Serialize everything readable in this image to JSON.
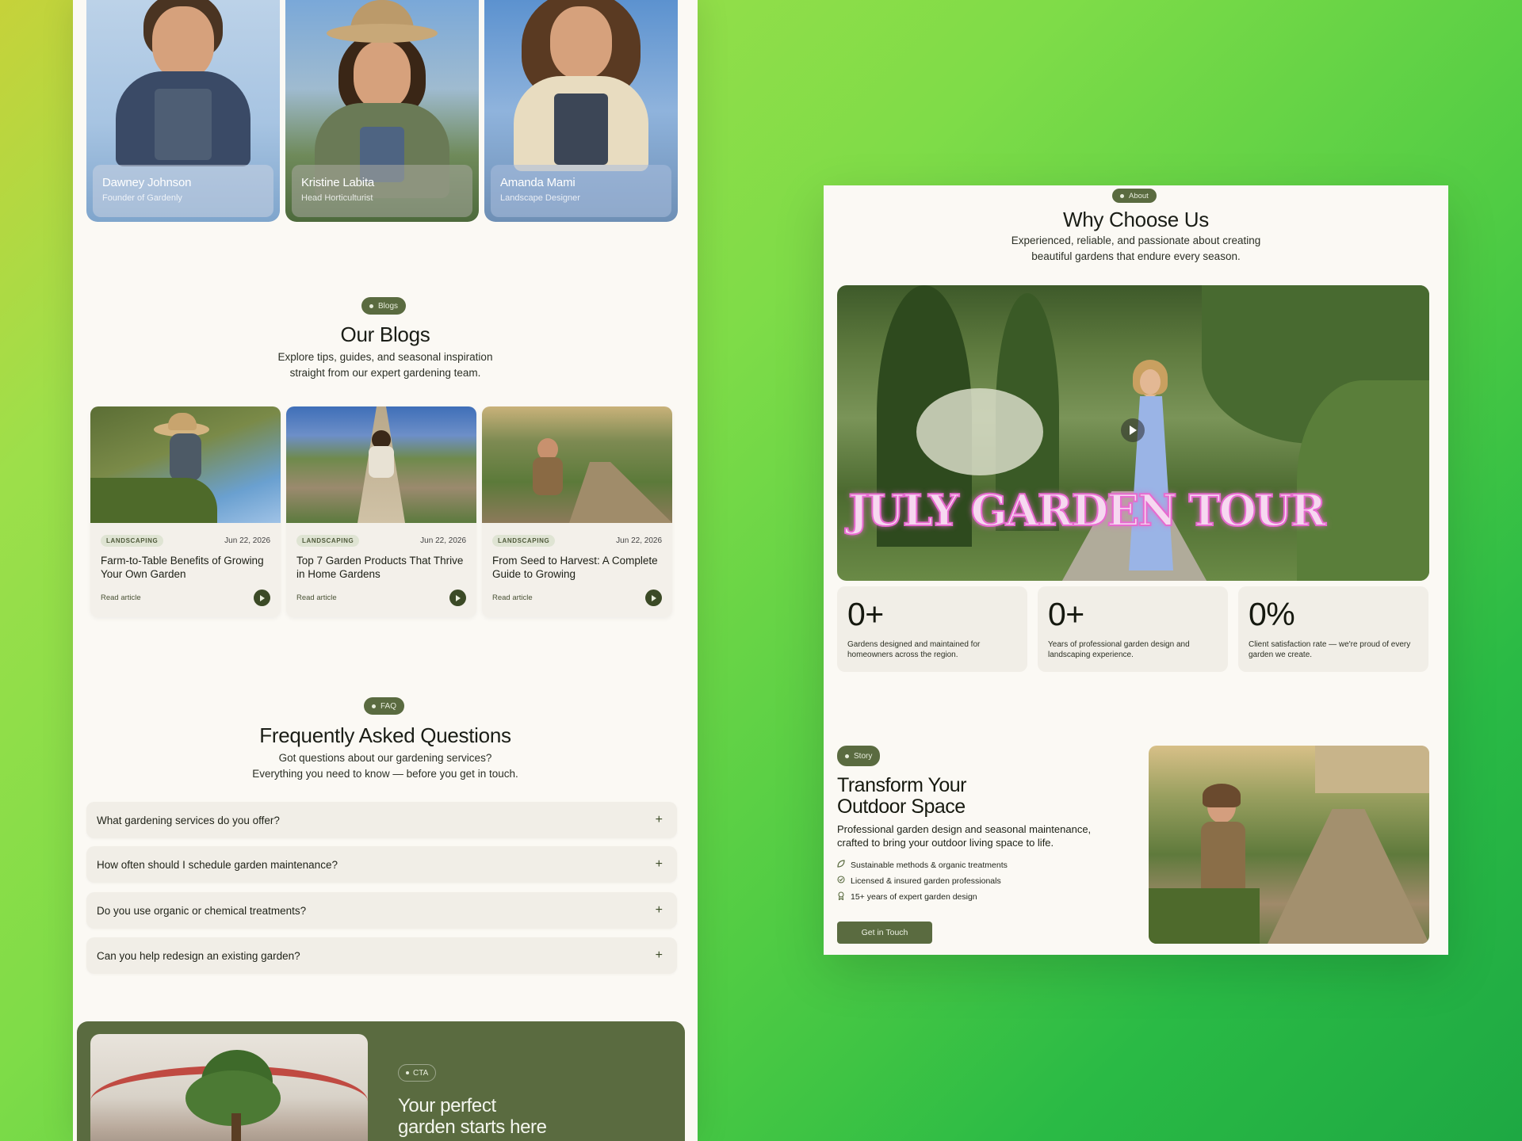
{
  "team": [
    {
      "name": "Dawney Johnson",
      "role": "Founder of Gardenly"
    },
    {
      "name": "Kristine Labita",
      "role": "Head Horticulturist"
    },
    {
      "name": "Amanda Mami",
      "role": "Landscape Designer"
    }
  ],
  "blogs": {
    "pill": "Blogs",
    "title": "Our Blogs",
    "subtitle_line1": "Explore tips, guides, and seasonal inspiration",
    "subtitle_line2": "straight from our expert gardening team.",
    "posts": [
      {
        "tag": "LANDSCAPING",
        "date": "Jun 22, 2026",
        "title": "Farm-to-Table Benefits of Growing Your Own Garden",
        "read": "Read article"
      },
      {
        "tag": "LANDSCAPING",
        "date": "Jun 22, 2026",
        "title": "Top 7 Garden Products That Thrive in Home Gardens",
        "read": "Read article"
      },
      {
        "tag": "LANDSCAPING",
        "date": "Jun 22, 2026",
        "title": "From Seed to Harvest: A Complete Guide to Growing",
        "read": "Read article"
      }
    ]
  },
  "faq": {
    "pill": "FAQ",
    "title": "Frequently Asked Questions",
    "subtitle_line1": "Got questions about our gardening services?",
    "subtitle_line2": "Everything you need to know — before you get in touch.",
    "questions": [
      "What gardening services do you offer?",
      "How often should I schedule garden maintenance?",
      "Do you use organic or chemical treatments?",
      "Can you help redesign an existing garden?"
    ],
    "expand_icon": "+"
  },
  "cta": {
    "pill": "CTA",
    "title_line1": "Your perfect",
    "title_line2": "garden starts here"
  },
  "about": {
    "pill": "About",
    "title": "Why Choose Us",
    "subtitle_line1": "Experienced, reliable, and passionate about creating",
    "subtitle_line2": "beautiful gardens that endure every season.",
    "video_caption": "JULY GARDEN TOUR",
    "stats": [
      {
        "value": "0+",
        "desc": "Gardens designed and maintained for homeowners across the region."
      },
      {
        "value": "0+",
        "desc": "Years of professional garden design and landscaping experience."
      },
      {
        "value": "0%",
        "desc": "Client satisfaction rate — we're proud of every garden we create."
      }
    ]
  },
  "story": {
    "pill": "Story",
    "title_line1": "Transform Your",
    "title_line2": "Outdoor Space",
    "desc": "Professional garden design and seasonal maintenance, crafted to bring your outdoor living space to life.",
    "points": [
      {
        "icon": "leaf-icon",
        "text": "Sustainable methods & organic treatments"
      },
      {
        "icon": "check-circle-icon",
        "text": "Licensed & insured garden professionals"
      },
      {
        "icon": "award-icon",
        "text": "15+ years of expert garden design"
      }
    ],
    "button": "Get in Touch"
  },
  "colors": {
    "brand_green": "#5a6b40",
    "page_bg": "#fbf9f4",
    "card_bg": "#f1eee7",
    "caption_pink": "#e86ad0"
  }
}
